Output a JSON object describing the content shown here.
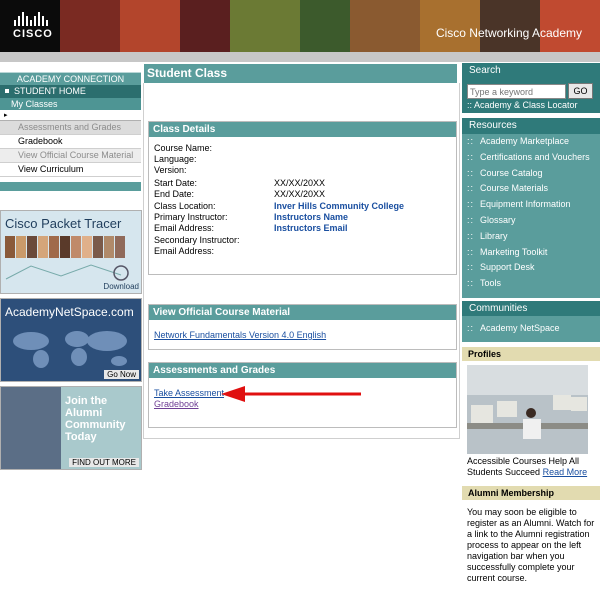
{
  "header": {
    "logo_text": "CISCO",
    "academy_title": "Cisco Networking Academy"
  },
  "left_nav": {
    "academy_connection": "ACADEMY CONNECTION",
    "student_home": "STUDENT HOME",
    "my_classes": "My Classes",
    "arrow": "▸",
    "sub_items": [
      "Assessments and Grades",
      "Gradebook",
      "View Official Course Material",
      "View Curriculum"
    ]
  },
  "promos": {
    "packet_tracer_title": "Cisco Packet Tracer",
    "packet_tracer_link": "Download",
    "academynetspace_title": "AcademyNetSpace.com",
    "academynetspace_link": "Go Now",
    "alumni_title": "Join the Alumni Community Today",
    "alumni_link": "FIND OUT MORE"
  },
  "main": {
    "page_title": "Student Class",
    "class_details": {
      "heading": "Class Details",
      "fields": [
        {
          "label": "Course Name:",
          "value": ""
        },
        {
          "label": "Language:",
          "value": ""
        },
        {
          "label": "Version:",
          "value": ""
        },
        {
          "label": "Start Date:",
          "value": "XX/XX/20XX"
        },
        {
          "label": "End Date:",
          "value": "XX/XX/20XX"
        },
        {
          "label": "Class Location:",
          "value": "Inver Hills Community College"
        },
        {
          "label": "Primary Instructor:",
          "value": "Instructors Name"
        },
        {
          "label": "Email Address:",
          "value": "Instructors Email"
        },
        {
          "label": "Secondary Instructor:",
          "value": ""
        },
        {
          "label": "Email Address:",
          "value": ""
        }
      ]
    },
    "course_material": {
      "heading": "View Official Course Material",
      "link": "Network Fundamentals Version 4.0 English"
    },
    "assessments": {
      "heading": "Assessments and Grades",
      "take_assessment": "Take Assessment",
      "gradebook": "Gradebook"
    }
  },
  "right": {
    "search": {
      "heading": "Search",
      "placeholder": "Type a keyword",
      "go": "GO",
      "locator": ":: Academy & Class Locator"
    },
    "resources": {
      "heading": "Resources",
      "items": [
        "Academy Marketplace",
        "Certifications and Vouchers",
        "Course Catalog",
        "Course Materials",
        "Equipment Information",
        "Glossary",
        "Library",
        "Marketing Toolkit",
        "Support Desk",
        "Tools"
      ]
    },
    "communities": {
      "heading": "Communities",
      "items": [
        "Academy NetSpace"
      ]
    },
    "profiles": {
      "heading": "Profiles",
      "caption": "Accessible Courses Help All Students Succeed",
      "read_more": "Read More"
    },
    "alumni": {
      "heading": "Alumni Membership",
      "text": "You may soon be eligible to register as an Alumni. Watch for a link to the Alumni registration process to appear on the left navigation bar when you successfully complete your current course."
    }
  },
  "colors": {
    "teal_dark": "#2f7a7a",
    "teal": "#5a9d9c",
    "link_blue": "#1a4fa0",
    "arrow_red": "#e01010",
    "profile_tan": "#e2dbb0"
  }
}
